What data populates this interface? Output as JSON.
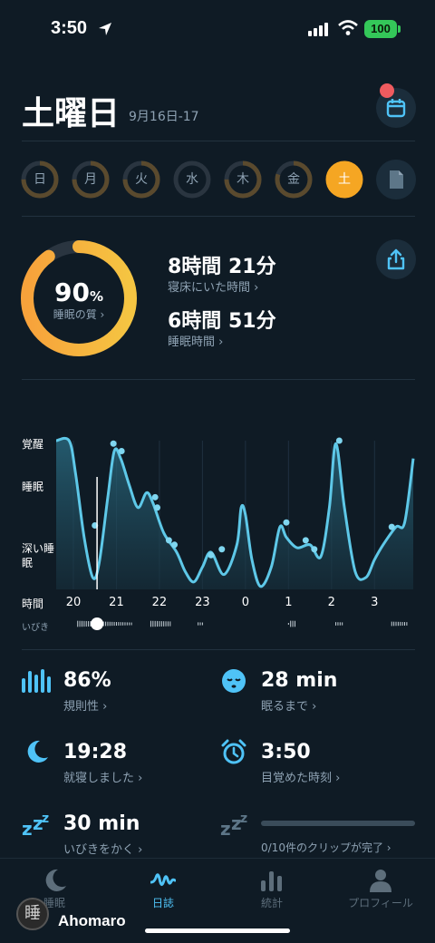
{
  "status_bar": {
    "time": "3:50",
    "battery": "100"
  },
  "header": {
    "day": "土曜日",
    "date": "9月16日-17"
  },
  "week": {
    "days": [
      {
        "label": "日",
        "progress": 0.75,
        "active": false
      },
      {
        "label": "月",
        "progress": 0.75,
        "active": false
      },
      {
        "label": "火",
        "progress": 0.75,
        "active": false
      },
      {
        "label": "水",
        "progress": 0.0,
        "active": false
      },
      {
        "label": "木",
        "progress": 0.75,
        "active": false
      },
      {
        "label": "金",
        "progress": 0.8,
        "active": false
      },
      {
        "label": "土",
        "progress": 0.9,
        "active": true
      }
    ]
  },
  "summary": {
    "quality_value": "90",
    "quality_unit": "%",
    "quality_label": "睡眠の質 ›",
    "quality_fraction": 0.9,
    "in_bed_value": "8時間 21分",
    "in_bed_label": "寝床にいた時間 ›",
    "asleep_value": "6時間 51分",
    "asleep_label": "睡眠時間 ›"
  },
  "chart_data": {
    "type": "line",
    "y_levels": [
      "覚醒",
      "睡眠",
      "深い睡眠"
    ],
    "x_title": "時間",
    "snore_title": "いびき",
    "x_ticks": [
      "20",
      "21",
      "22",
      "23",
      "0",
      "1",
      "2",
      "3"
    ],
    "x_tick_hours": [
      20,
      21,
      22,
      23,
      24,
      25,
      26,
      27
    ],
    "x_range": [
      19.6,
      27.9
    ],
    "y_range": [
      0,
      1
    ],
    "series": [
      {
        "points": [
          [
            19.6,
            1.0
          ],
          [
            19.9,
            1.0
          ],
          [
            20.05,
            0.78
          ],
          [
            20.25,
            0.35
          ],
          [
            20.45,
            0.08
          ],
          [
            20.6,
            0.18
          ],
          [
            20.8,
            0.62
          ],
          [
            20.95,
            0.93
          ],
          [
            21.1,
            0.88
          ],
          [
            21.3,
            0.7
          ],
          [
            21.5,
            0.55
          ],
          [
            21.7,
            0.65
          ],
          [
            21.85,
            0.58
          ],
          [
            22.1,
            0.38
          ],
          [
            22.4,
            0.25
          ],
          [
            22.6,
            0.12
          ],
          [
            22.8,
            0.05
          ],
          [
            23.0,
            0.15
          ],
          [
            23.2,
            0.25
          ],
          [
            23.5,
            0.1
          ],
          [
            23.8,
            0.3
          ],
          [
            23.9,
            0.55
          ],
          [
            24.0,
            0.5
          ],
          [
            24.15,
            0.2
          ],
          [
            24.35,
            0.02
          ],
          [
            24.6,
            0.15
          ],
          [
            24.8,
            0.42
          ],
          [
            24.95,
            0.35
          ],
          [
            25.2,
            0.28
          ],
          [
            25.5,
            0.3
          ],
          [
            25.75,
            0.22
          ],
          [
            25.95,
            0.55
          ],
          [
            26.1,
            0.98
          ],
          [
            26.3,
            0.55
          ],
          [
            26.55,
            0.12
          ],
          [
            26.8,
            0.08
          ],
          [
            27.0,
            0.2
          ],
          [
            27.2,
            0.3
          ],
          [
            27.5,
            0.42
          ],
          [
            27.7,
            0.45
          ],
          [
            27.9,
            0.88
          ]
        ]
      }
    ],
    "markers": [
      [
        20.5,
        0.43
      ],
      [
        20.93,
        0.98
      ],
      [
        21.12,
        0.93
      ],
      [
        21.9,
        0.62
      ],
      [
        21.95,
        0.55
      ],
      [
        22.22,
        0.33
      ],
      [
        22.35,
        0.3
      ],
      [
        23.2,
        0.23
      ],
      [
        23.45,
        0.27
      ],
      [
        24.95,
        0.45
      ],
      [
        25.4,
        0.33
      ],
      [
        25.6,
        0.27
      ],
      [
        26.18,
        1.0
      ],
      [
        27.4,
        0.42
      ]
    ],
    "cursor_hour": 20.55,
    "snore_cursor_hour": 20.55
  },
  "stats": {
    "regularity_value": "86%",
    "regularity_label": "規則性 ›",
    "fall_asleep_value": "28 min",
    "fall_asleep_label": "眠るまで ›",
    "bedtime_value": "19:28",
    "bedtime_label": "就寝しました ›",
    "wake_value": "3:50",
    "wake_label": "目覚めた時刻 ›",
    "snore_value": "30 min",
    "snore_label": "いびきをかく ›",
    "clips_label": "0/10件のクリップが完了 ›"
  },
  "tabs": [
    {
      "label": "睡眠",
      "icon": "moon-icon",
      "active": false
    },
    {
      "label": "日誌",
      "icon": "wave-icon",
      "active": true
    },
    {
      "label": "統計",
      "icon": "bar-chart-icon",
      "active": false
    },
    {
      "label": "プロフィール",
      "icon": "person-icon",
      "active": false
    }
  ],
  "watermark": {
    "seal": "睡",
    "text": "Ahomaro"
  },
  "colors": {
    "background": "#0f1b25",
    "accent_blue": "#4fc3f7",
    "accent_orange": "#f5a623",
    "ring_inactive": "#5a4a2e"
  }
}
